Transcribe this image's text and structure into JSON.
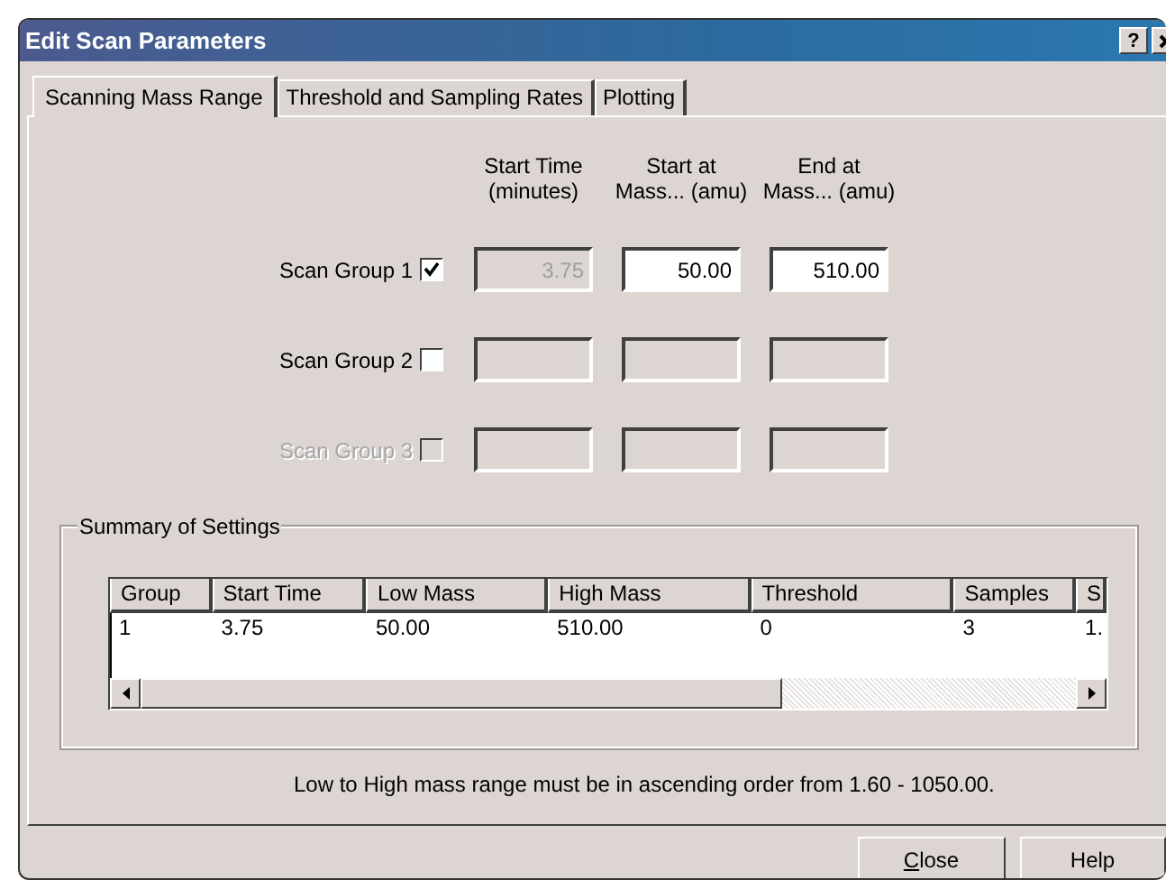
{
  "window": {
    "title": "Edit Scan Parameters",
    "help_button": "?"
  },
  "tabs": [
    {
      "label": "Scanning Mass Range",
      "selected": true
    },
    {
      "label": "Threshold and Sampling Rates",
      "selected": false
    },
    {
      "label": "Plotting",
      "selected": false
    }
  ],
  "column_headers": [
    {
      "line1": "Start Time",
      "line2": "(minutes)"
    },
    {
      "line1": "Start at",
      "line2": "Mass... (amu)"
    },
    {
      "line1": "End at",
      "line2": "Mass... (amu)"
    }
  ],
  "scan_groups": [
    {
      "label": "Scan Group 1",
      "checked": true,
      "disabled": false,
      "fields": [
        {
          "value": "3.75",
          "disabled": true
        },
        {
          "value": "50.00",
          "disabled": false
        },
        {
          "value": "510.00",
          "disabled": false
        }
      ]
    },
    {
      "label": "Scan Group 2",
      "checked": false,
      "disabled": false,
      "fields": [
        {
          "disabled": true
        },
        {
          "disabled": true
        },
        {
          "disabled": true
        }
      ]
    },
    {
      "label": "Scan Group 3",
      "checked": false,
      "disabled": true,
      "fields": [
        {
          "disabled": true
        },
        {
          "disabled": true
        },
        {
          "disabled": true
        }
      ]
    }
  ],
  "summary": {
    "title": "Summary of Settings",
    "table": {
      "columns": [
        "Group",
        "Start Time",
        "Low Mass",
        "High Mass",
        "Threshold",
        "Samples",
        "S"
      ],
      "rows": [
        [
          "1",
          "3.75",
          "50.00",
          "510.00",
          "0",
          "3",
          "1."
        ]
      ]
    }
  },
  "note": "Low to High mass range must be in ascending order from 1.60  -  1050.00.",
  "buttons": [
    {
      "label": "Close",
      "mnemonic_underlined": true
    },
    {
      "label": "Help",
      "mnemonic_underlined": false
    }
  ]
}
